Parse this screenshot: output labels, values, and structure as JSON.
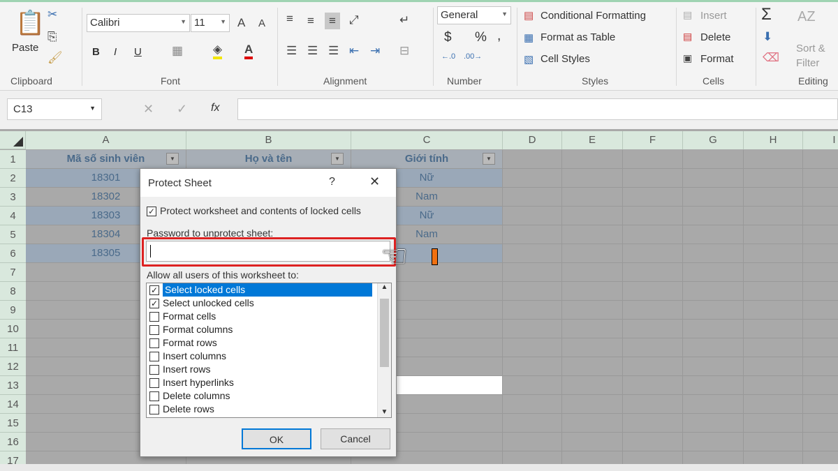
{
  "ribbon": {
    "clipboard": {
      "label": "Clipboard",
      "paste": "Paste"
    },
    "font": {
      "label": "Font",
      "name": "Calibri",
      "size": "11",
      "bold": "B",
      "italic": "I",
      "underline": "U"
    },
    "alignment": {
      "label": "Alignment"
    },
    "number": {
      "label": "Number",
      "format": "General",
      "currency": "$",
      "percent": "%",
      "comma": ","
    },
    "styles": {
      "label": "Styles",
      "conditional": "Conditional Formatting",
      "format_table": "Format as Table",
      "cell_styles": "Cell Styles"
    },
    "cells": {
      "label": "Cells",
      "insert": "Insert",
      "delete": "Delete",
      "format": "Format"
    },
    "editing": {
      "label": "Editing",
      "sum": "Σ",
      "sort_filter_1": "Sort &",
      "sort_filter_2": "Filter"
    }
  },
  "formula_bar": {
    "name_box": "C13",
    "fx": "fx",
    "value": ""
  },
  "columns": [
    "A",
    "B",
    "C",
    "D",
    "E",
    "F",
    "G",
    "H",
    "I"
  ],
  "rows": [
    "1",
    "2",
    "3",
    "4",
    "5",
    "6",
    "7",
    "8",
    "9",
    "10",
    "11",
    "12",
    "13",
    "14",
    "15",
    "16",
    "17"
  ],
  "table": {
    "headers": [
      "Mã số sinh viên",
      "Họ và tên",
      "Giới tính"
    ],
    "data": [
      [
        "18301",
        "",
        "Nữ"
      ],
      [
        "18302",
        "",
        "Nam"
      ],
      [
        "18303",
        "",
        "Nữ"
      ],
      [
        "18304",
        "",
        "Nam"
      ],
      [
        "18305",
        "",
        ""
      ]
    ]
  },
  "dialog": {
    "title": "Protect Sheet",
    "help": "?",
    "close": "✕",
    "protect_label": "Protect worksheet and contents of locked cells",
    "protect_checked": true,
    "password_label": "Password to unprotect sheet:",
    "password_value": "",
    "allow_label": "Allow all users of this worksheet to:",
    "permissions": [
      {
        "label": "Select locked cells",
        "checked": true,
        "selected": true
      },
      {
        "label": "Select unlocked cells",
        "checked": true
      },
      {
        "label": "Format cells",
        "checked": false
      },
      {
        "label": "Format columns",
        "checked": false
      },
      {
        "label": "Format rows",
        "checked": false
      },
      {
        "label": "Insert columns",
        "checked": false
      },
      {
        "label": "Insert rows",
        "checked": false
      },
      {
        "label": "Insert hyperlinks",
        "checked": false
      },
      {
        "label": "Delete columns",
        "checked": false
      },
      {
        "label": "Delete rows",
        "checked": false
      }
    ],
    "ok": "OK",
    "cancel": "Cancel"
  },
  "colors": {
    "highlight": "#d22222",
    "selection": "#0078d7",
    "header_bg": "#d9e8dd"
  }
}
